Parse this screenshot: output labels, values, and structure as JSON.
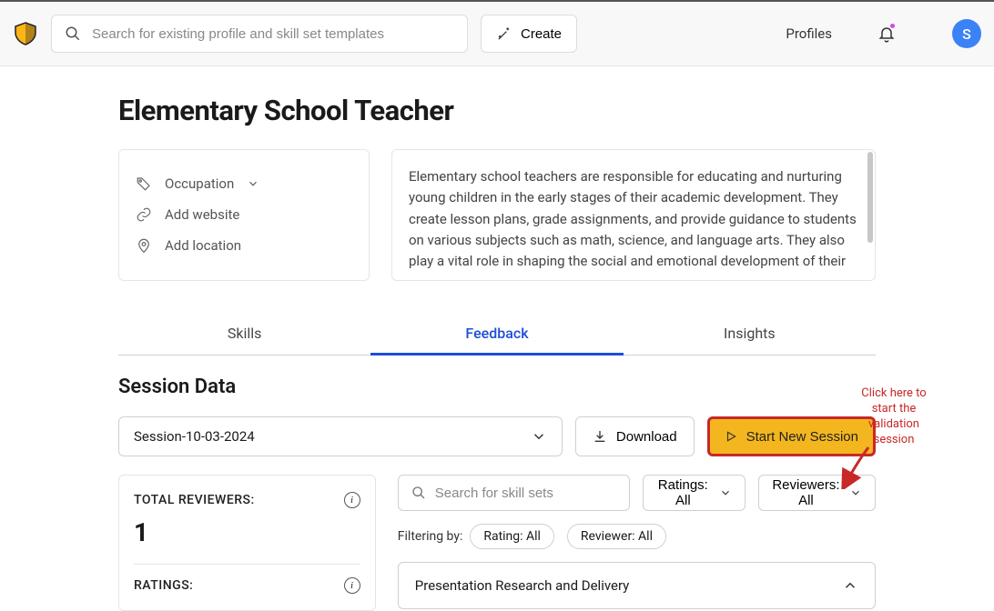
{
  "header": {
    "search_placeholder": "Search for existing profile and skill set templates",
    "create_label": "Create",
    "nav_profiles": "Profiles",
    "avatar_initial": "S"
  },
  "page": {
    "title": "Elementary School Teacher",
    "meta": {
      "occupation_label": "Occupation",
      "add_website": "Add website",
      "add_location": "Add location"
    },
    "description": "Elementary school teachers are responsible for educating and nurturing young children in the early stages of their academic development. They create lesson plans, grade assignments, and provide guidance to students on various subjects such as math, science, and language arts. They also play a vital role in shaping the social and emotional development of their"
  },
  "tabs": {
    "skills": "Skills",
    "feedback": "Feedback",
    "insights": "Insights"
  },
  "session": {
    "section_title": "Session Data",
    "selected": "Session-10-03-2024",
    "download": "Download",
    "start_new": "Start New Session"
  },
  "stats": {
    "total_reviewers_label": "TOTAL REVIEWERS:",
    "total_reviewers_value": "1",
    "ratings_label": "RATINGS:"
  },
  "filters": {
    "skill_search_placeholder": "Search for skill sets",
    "ratings_btn": "Ratings: All",
    "reviewers_btn": "Reviewers: All",
    "filtering_by": "Filtering by:",
    "chip_rating": "Rating: All",
    "chip_reviewer": "Reviewer: All"
  },
  "skills_list": {
    "item1": "Presentation Research and Delivery"
  },
  "callout": {
    "text": "Click here to start the validation session"
  },
  "colors": {
    "accent_blue": "#1d4ed8",
    "highlight_red": "#c82828",
    "highlight_yellow": "#f4b61e"
  }
}
